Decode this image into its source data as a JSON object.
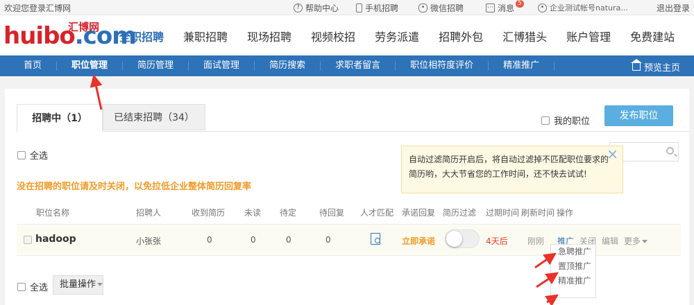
{
  "topbar": {
    "welcome": "欢迎您登录汇博网",
    "help": "帮助中心",
    "mobile": "手机招聘",
    "wechat": "微信招聘",
    "messages": "消息",
    "message_count": "5",
    "account": "企业测试帐号natura...",
    "logout": "退出登录"
  },
  "logo": {
    "text_red": "huibo",
    "text_blue": ".com",
    "cn": "汇博网"
  },
  "mainnav": [
    "全职招聘",
    "兼职招聘",
    "现场招聘",
    "视频校招",
    "劳务派遣",
    "招聘外包",
    "汇博猎头",
    "账户管理",
    "免费建站"
  ],
  "subnav": {
    "items": [
      "首页",
      "职位管理",
      "简历管理",
      "面试管理",
      "简历搜索",
      "求职者留言",
      "职位相符度评价",
      "精准推广"
    ],
    "preview": "预览主页"
  },
  "tabs": {
    "active": "招聘中（1）",
    "ended": "已结束招聘（34）"
  },
  "my_positions": "我的职位",
  "publish_button": "发布职位",
  "select_all": "全选",
  "tip": {
    "line1": "自动过滤简历开启后，将自动过滤掉不匹配职位要求的",
    "line2": "简历哟，大大节省您的工作时间，还不快去试试!"
  },
  "warning": "没在招聘的职位请及时关闭，以免拉低企业整体简历回复率",
  "columns": [
    "职位名称",
    "招聘人",
    "收到简历",
    "未读",
    "待定",
    "待回复",
    "人才匹配",
    "承诺回复",
    "简历过滤",
    "过期时间",
    "刷新时间",
    "操作"
  ],
  "job": {
    "name": "hadoop",
    "recruiter": "小张张",
    "received": "0",
    "unread": "0",
    "pending": "0",
    "to_reply": "0",
    "promise": "立即承诺",
    "expire": "4天后",
    "refresh": "刚刚",
    "ops": [
      "推广",
      "关闭",
      "编辑",
      "更多"
    ]
  },
  "dropdown": [
    "急聘推广",
    "置顶推广",
    "精准推广"
  ],
  "batch": "批量操作",
  "colors": {
    "brand_blue": "#2e72b8",
    "brand_red": "#d8232a",
    "warning": "#f39a26",
    "annotation_arrow": "#e8322a"
  }
}
